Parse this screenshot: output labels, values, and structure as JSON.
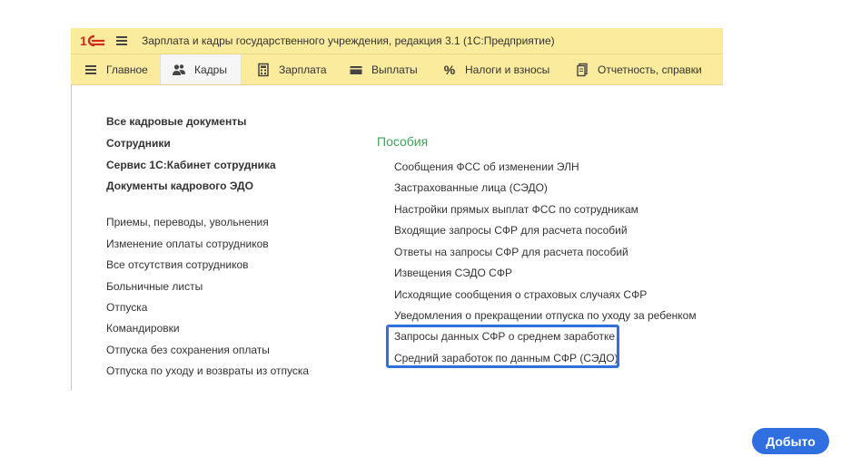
{
  "app": {
    "title": "Зарплата и кадры государственного учреждения, редакция 3.1  (1С:Предприятие)"
  },
  "nav": {
    "items": [
      {
        "label": "Главное"
      },
      {
        "label": "Кадры"
      },
      {
        "label": "Зарплата"
      },
      {
        "label": "Выплаты"
      },
      {
        "label": "Налоги и взносы"
      },
      {
        "label": "Отчетность, справки"
      }
    ]
  },
  "left_links": {
    "bold": [
      "Все кадровые документы",
      "Сотрудники",
      "Сервис 1С:Кабинет сотрудника",
      "Документы кадрового ЭДО"
    ],
    "regular": [
      "Приемы, переводы, увольнения",
      "Изменение оплаты сотрудников",
      "Все отсутствия сотрудников",
      "Больничные листы",
      "Отпуска",
      "Командировки",
      "Отпуска без сохранения оплаты",
      "Отпуска по уходу и возвраты из отпуска"
    ]
  },
  "benefits": {
    "title": "Пособия",
    "links": [
      "Сообщения ФСС об изменении ЭЛН",
      "Застрахованные лица (СЭДО)",
      "Настройки прямых выплат ФСС по сотрудникам",
      "Входящие запросы СФР для расчета пособий",
      "Ответы на запросы СФР для расчета пособий",
      "Извещения СЭДО СФР",
      "Исходящие сообщения о страховых случаях СФР",
      "Уведомления о прекращении отпуска по уходу за ребенком",
      "Запросы данных СФР о среднем заработке",
      "Средний заработок по данным СФР (СЭДО)"
    ]
  },
  "colors": {
    "header_bg": "#fbeb9d",
    "accent_green": "#3aa55a",
    "highlight_blue": "#2f6fdf",
    "logo_red": "#d52b1e"
  },
  "action_button": {
    "label": "Добыто"
  }
}
